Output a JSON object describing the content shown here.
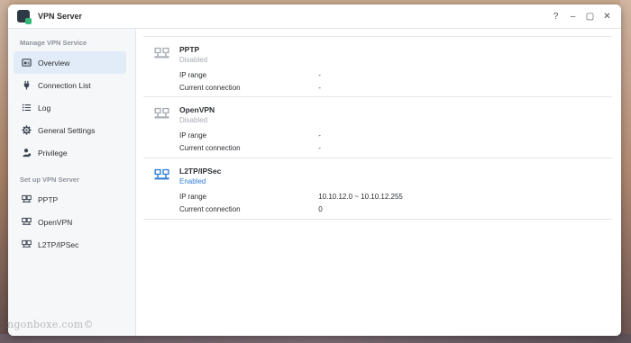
{
  "window": {
    "title": "VPN Server",
    "controls": [
      "?",
      "–",
      "▢",
      "✕"
    ]
  },
  "sidebar": {
    "manage_title": "Manage VPN Service",
    "manage_items": [
      {
        "label": "Overview",
        "icon": "overview-icon",
        "active": true
      },
      {
        "label": "Connection List",
        "icon": "plug-icon"
      },
      {
        "label": "Log",
        "icon": "list-icon"
      },
      {
        "label": "General Settings",
        "icon": "gear-icon"
      },
      {
        "label": "Privilege",
        "icon": "user-icon"
      }
    ],
    "setup_title": "Set up VPN Server",
    "setup_items": [
      {
        "label": "PPTP",
        "icon": "monitor-icon"
      },
      {
        "label": "OpenVPN",
        "icon": "monitor-icon"
      },
      {
        "label": "L2TP/IPSec",
        "icon": "monitor-icon"
      }
    ]
  },
  "services": [
    {
      "name": "PPTP",
      "status": "Disabled",
      "ip_range_label": "IP range",
      "ip_range": "-",
      "connection_label": "Current connection",
      "connection": "-"
    },
    {
      "name": "OpenVPN",
      "status": "Disabled",
      "ip_range_label": "IP range",
      "ip_range": "-",
      "connection_label": "Current connection",
      "connection": "-"
    },
    {
      "name": "L2TP/IPSec",
      "status": "Enabled",
      "ip_range_label": "IP range",
      "ip_range": "10.10.12.0 ~ 10.10.12.255",
      "connection_label": "Current connection",
      "connection": "0"
    }
  ],
  "colors": {
    "accent": "#2f7fd6",
    "disabled": "#a7acb3",
    "active_bg": "#e2ecf8"
  },
  "watermark": "ngonboxe.com©"
}
